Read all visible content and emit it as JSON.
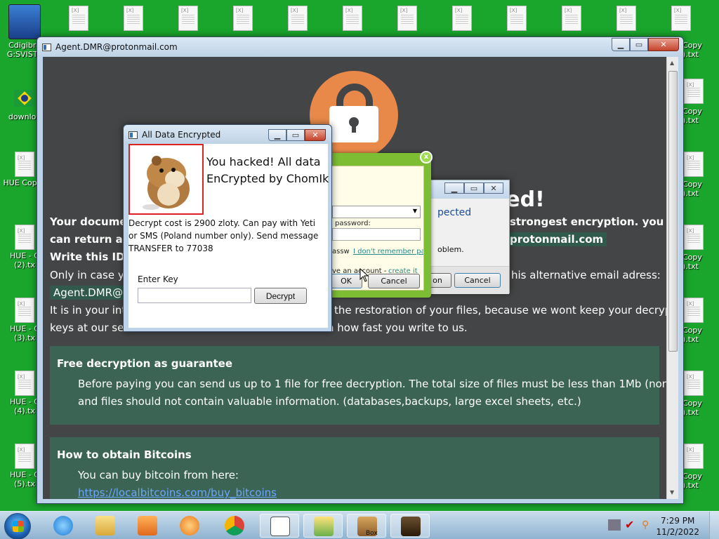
{
  "desktop": {
    "icons": [
      {
        "label": "Cdigibro G:SVISTA",
        "kind": "app"
      },
      {
        "label": "downloa",
        "kind": "flag"
      },
      {
        "label": "HUE Copy.t",
        "kind": "txt"
      },
      {
        "label": "HUE - C (2).tx",
        "kind": "txt"
      },
      {
        "label": "HUE - C (3).tx",
        "kind": "txt"
      },
      {
        "label": "HUE - C (4).tx",
        "kind": "txt"
      },
      {
        "label": "HUE - C (5).tx",
        "kind": "txt"
      }
    ],
    "right_icons": [
      "Copy ).txt",
      "Copy ).txt",
      "Copy ).txt",
      "Copy ).txt",
      "Copy ).txt",
      "Copy ).txt",
      "Copy ).txt"
    ]
  },
  "main_window": {
    "title": "Agent.DMR@protonmail.com",
    "headline": "ncrypted!",
    "line1_left": "Your documen",
    "line1_right": "strongest encryption. you",
    "line2_left": "can return all",
    "line2_email": "protonmail.com",
    "line3": "Write this ID i",
    "line4_left": "Only in case you",
    "line4_right": "his alternative email adress:",
    "line5_email": "Agent.DMR@ac",
    "line6_left": "It is in your inter",
    "line6_right": "the restoration of your files, because we wont keep your decryption",
    "line7_left": "keys at our serv",
    "line7_right": "n how fast you write to us.",
    "panel1": {
      "heading": "Free decryption as guarantee",
      "text1": "Before paying you can send us up to 1 file for free decryption. The total size of files must be less than 1Mb (non archived),",
      "text2": "and files should not contain valuable information. (databases,backups, large excel sheets, etc.)"
    },
    "panel2": {
      "heading": "How to obtain Bitcoins",
      "text1": "You can buy bitcoin from here:",
      "link": "https://localbitcoins.com/buy_bitcoins"
    }
  },
  "green_popup": {
    "password_label": "password:",
    "passw_frag": "assw",
    "forgot_link": "I don't remember pas",
    "no_account": "ve an account -",
    "create_link": "create it",
    "ok_label": "OK",
    "cancel_label": "Cancel",
    "close_glyph": "x"
  },
  "gray_dialog": {
    "text1": "pected",
    "text2": "oblem.",
    "btn1": "on",
    "btn2": "Cancel"
  },
  "hamster_dialog": {
    "title": "All Data Encrypted",
    "headline1": "You hacked! All data",
    "headline2": "EnCrypted by ChomIk",
    "body1": "Decrypt cost is 2900 zloty. Can pay with Yeti",
    "body2": "or SMS (Poland number only). Send message",
    "body3": "TRANSFER to 77038",
    "key_label": "Enter Key",
    "key_value": "",
    "decrypt_label": "Decrypt"
  },
  "taskbar": {
    "time": "7:29 PM",
    "date": "11/2/2022",
    "box_label": "Box"
  }
}
